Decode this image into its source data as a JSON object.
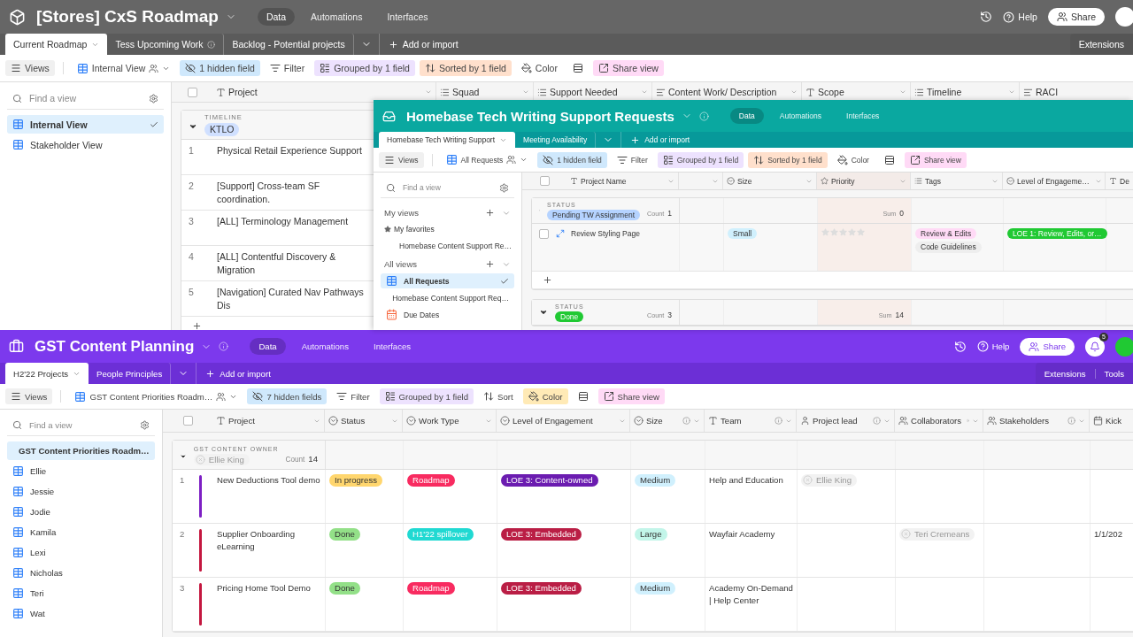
{
  "windows": [
    {
      "title": "[Stores] CxS Roadmap",
      "info": false,
      "all_selected": false,
      "nav": [
        {
          "label": "Data",
          "selected": true
        },
        {
          "label": "Automations",
          "selected": false
        },
        {
          "label": "Interfaces",
          "selected": false
        }
      ],
      "header_right": {
        "help": "Help",
        "share": "Share"
      },
      "tabs": [
        {
          "label": "Current Roadmap",
          "selected": true,
          "info": false
        },
        {
          "label": "Tess Upcoming Work",
          "selected": false,
          "info": true
        },
        {
          "label": "Backlog - Potential projects",
          "selected": false,
          "info": false
        }
      ],
      "add_label": "Add or import",
      "side_tabs": [
        "Extensions"
      ],
      "toolbar": [
        {
          "kind": "views",
          "label": "Views"
        },
        {
          "kind": "view",
          "label": "Internal View"
        },
        {
          "kind": "hidden",
          "label": "1 hidden field",
          "active": true
        },
        {
          "kind": "filter",
          "label": "Filter",
          "active": false
        },
        {
          "kind": "group",
          "label": "Grouped by 1 field",
          "active": true
        },
        {
          "kind": "sort",
          "label": "Sorted by 1 field",
          "active": true
        },
        {
          "kind": "color",
          "label": "Color",
          "active": false
        },
        {
          "kind": "row_height"
        },
        {
          "kind": "share",
          "label": "Share view"
        }
      ],
      "sidebar": {
        "placeholder": "Find a view",
        "items": [
          {
            "kind": "grid",
            "label": "Internal View",
            "selected": true
          },
          {
            "kind": "grid",
            "label": "Stakeholder View",
            "selected": false
          }
        ]
      },
      "columns": [
        {
          "kind": "text",
          "label": "Project",
          "info": false,
          "sorted": false
        },
        {
          "kind": "multi",
          "label": "Squad",
          "info": false,
          "sorted": false
        },
        {
          "kind": "multi",
          "label": "Support Needed",
          "info": false,
          "sorted": false
        },
        {
          "kind": "longtext",
          "label": "Content Work/ Description",
          "info": false,
          "sorted": false
        },
        {
          "kind": "text",
          "label": "Scope",
          "info": false,
          "sorted": false
        },
        {
          "kind": "multi",
          "label": "Timeline",
          "info": false,
          "sorted": false
        },
        {
          "kind": "longtext",
          "label": "RACI",
          "info": false,
          "sorted": false
        }
      ],
      "groups": [
        {
          "field": "TIMELINE",
          "value": {
            "kind": "tag",
            "label": "KTLO",
            "color": "#d0e0ff"
          },
          "add_row": true,
          "rows": [
            {
              "number": "1",
              "hovered": false,
              "cells": [
                {
                  "kind": "text",
                  "text": "Physical Retail Experience Support"
                }
              ]
            },
            {
              "number": "2",
              "hovered": false,
              "cells": [
                {
                  "kind": "text",
                  "text": "[Support] Cross-team SF coordination."
                }
              ]
            },
            {
              "number": "3",
              "hovered": false,
              "cells": [
                {
                  "kind": "text",
                  "text": "[ALL] Terminology Management"
                }
              ]
            },
            {
              "number": "4",
              "hovered": false,
              "cells": [
                {
                  "kind": "text",
                  "text": "[ALL] Contentful Discovery & Migration"
                }
              ]
            },
            {
              "number": "5",
              "hovered": false,
              "cells": [
                {
                  "kind": "text",
                  "text": "[Navigation] Curated Nav Pathways Dis"
                }
              ]
            }
          ]
        }
      ]
    },
    {
      "title": "Homebase Tech Writing Support Requests",
      "info": true,
      "all_selected": false,
      "nav": [
        {
          "label": "Data",
          "selected": true
        },
        {
          "label": "Automations",
          "selected": false
        },
        {
          "label": "Interfaces",
          "selected": false
        }
      ],
      "tabs": [
        {
          "label": "Homebase Tech Writing Support",
          "selected": true,
          "info": false
        },
        {
          "label": "Meeting Availability",
          "selected": false,
          "info": false
        }
      ],
      "add_label": "Add or import",
      "toolbar": [
        {
          "kind": "views",
          "label": "Views"
        },
        {
          "kind": "view",
          "label": "All Requests"
        },
        {
          "kind": "hidden",
          "label": "1 hidden field",
          "active": true
        },
        {
          "kind": "filter",
          "label": "Filter",
          "active": false
        },
        {
          "kind": "group",
          "label": "Grouped by 1 field",
          "active": true
        },
        {
          "kind": "sort",
          "label": "Sorted by 1 field",
          "active": true
        },
        {
          "kind": "color",
          "label": "Color",
          "active": false
        },
        {
          "kind": "row_height"
        },
        {
          "kind": "share",
          "label": "Share view"
        }
      ],
      "sidebar": {
        "placeholder": "Find a view",
        "items": [
          {
            "kind": "section",
            "label": "My views"
          },
          {
            "kind": "favorites",
            "label": "My favorites"
          },
          {
            "kind": "form",
            "label": "Homebase Content Support Re…",
            "selected": false
          },
          {
            "kind": "section",
            "label": "All views"
          },
          {
            "kind": "grid",
            "label": "All Requests",
            "selected": true
          },
          {
            "kind": "form",
            "label": "Homebase Content Support Req…",
            "selected": false
          },
          {
            "kind": "calendar",
            "label": "Due Dates",
            "selected": false
          }
        ]
      },
      "columns": [
        {
          "kind": "text",
          "label": "Project Name",
          "info": false,
          "sorted": false
        },
        {
          "kind": "blank",
          "info": false,
          "sorted": false
        },
        {
          "kind": "select",
          "label": "Size",
          "info": false,
          "sorted": false
        },
        {
          "kind": "rating",
          "label": "Priority",
          "info": false,
          "sorted": true
        },
        {
          "kind": "multi",
          "label": "Tags",
          "info": false,
          "sorted": false
        },
        {
          "kind": "select",
          "label": "Level of Engageme…",
          "info": false,
          "sorted": false
        },
        {
          "kind": "text",
          "label": "De",
          "sorted": false
        }
      ],
      "groups": [
        {
          "field": "STATUS",
          "value": {
            "kind": "tag",
            "label": "Pending TW Assignment",
            "color": "#b5d3ff"
          },
          "count_label": "Count",
          "count": "1",
          "sum_label": "Sum",
          "sum": "0",
          "add_row": true,
          "rows": [
            {
              "hovered": true,
              "cells": [
                {
                  "kind": "text",
                  "text": "Review Styling Page"
                },
                {
                  "kind": "blank"
                },
                {
                  "kind": "tags",
                  "tags": [
                    {
                      "label": "Small",
                      "color": "#d0f0fd"
                    }
                  ]
                },
                {
                  "kind": "stars",
                  "stars": 0
                },
                {
                  "kind": "tags",
                  "tags": [
                    {
                      "label": "Review & Edits",
                      "color": "#ffdaf6"
                    },
                    {
                      "label": "Code Guidelines",
                      "color": "#eeeeee"
                    }
                  ]
                },
                {
                  "kind": "tags",
                  "tags": [
                    {
                      "label": "LOE 1: Review, Edits, or…",
                      "color": "#20c933"
                    }
                  ]
                },
                {
                  "kind": "blank"
                }
              ]
            }
          ]
        },
        {
          "field": "STATUS",
          "value": {
            "kind": "tag",
            "label": "Done",
            "color": "#20c933"
          },
          "count_label": "Count",
          "count": "3",
          "sum_label": "Sum",
          "sum": "14",
          "add_row": false
        }
      ]
    },
    {
      "title": "GST Content Planning",
      "info": true,
      "all_selected": false,
      "nav": [
        {
          "label": "Data",
          "selected": true
        },
        {
          "label": "Automations",
          "selected": false
        },
        {
          "label": "Interfaces",
          "selected": false
        }
      ],
      "header_right": {
        "help": "Help",
        "share": "Share",
        "notifications": "5"
      },
      "tabs": [
        {
          "label": "H2'22 Projects",
          "selected": true,
          "info": false
        },
        {
          "label": "People Principles",
          "selected": false,
          "info": false
        }
      ],
      "add_label": "Add or import",
      "side_tabs": [
        "Extensions",
        "Tools"
      ],
      "toolbar": [
        {
          "kind": "views",
          "label": "Views"
        },
        {
          "kind": "view",
          "label": "GST Content Priorities Roadm…"
        },
        {
          "kind": "hidden",
          "label": "7 hidden fields",
          "active": true
        },
        {
          "kind": "filter",
          "label": "Filter",
          "active": false
        },
        {
          "kind": "group",
          "label": "Grouped by 1 field",
          "active": true
        },
        {
          "kind": "sort",
          "label": "Sort",
          "active": false
        },
        {
          "kind": "color",
          "label": "Color",
          "active": true
        },
        {
          "kind": "row_height"
        },
        {
          "kind": "share",
          "label": "Share view"
        }
      ],
      "sidebar": {
        "placeholder": "Find a view",
        "items": [
          {
            "kind": "grid",
            "label": "GST Content Priorities Roadm…",
            "selected": true
          },
          {
            "kind": "grid",
            "label": "Ellie",
            "selected": false
          },
          {
            "kind": "grid",
            "label": "Jessie",
            "selected": false
          },
          {
            "kind": "grid",
            "label": "Jodie",
            "selected": false
          },
          {
            "kind": "grid",
            "label": "Kamila",
            "selected": false
          },
          {
            "kind": "grid",
            "label": "Lexi",
            "selected": false
          },
          {
            "kind": "grid",
            "label": "Nicholas",
            "selected": false
          },
          {
            "kind": "grid",
            "label": "Teri",
            "selected": false
          },
          {
            "kind": "grid",
            "label": "Wat",
            "selected": false
          }
        ]
      },
      "columns": [
        {
          "kind": "text",
          "label": "Project",
          "info": false,
          "sorted": false
        },
        {
          "kind": "select",
          "label": "Status",
          "info": false,
          "sorted": false
        },
        {
          "kind": "select",
          "label": "Work Type",
          "info": false,
          "sorted": false
        },
        {
          "kind": "select",
          "label": "Level of Engagement",
          "info": false,
          "sorted": false
        },
        {
          "kind": "select",
          "label": "Size",
          "info": true,
          "sorted": false
        },
        {
          "kind": "text",
          "label": "Team",
          "info": true,
          "sorted": false
        },
        {
          "kind": "user",
          "label": "Project lead",
          "info": true,
          "sorted": false
        },
        {
          "kind": "users",
          "label": "Collaborators",
          "info": true,
          "sorted": false
        },
        {
          "kind": "users",
          "label": "Stakeholders",
          "info": true,
          "sorted": false
        },
        {
          "kind": "date",
          "label": "Kick",
          "sorted": false
        }
      ],
      "groups": [
        {
          "field": "GST CONTENT OWNER",
          "value": {
            "kind": "person",
            "label": "Ellie King"
          },
          "count_label": "Count",
          "count": "14",
          "add_row": false,
          "rows": [
            {
              "number": "1",
              "hovered": false,
              "color": "#7d1fc4",
              "cells": [
                {
                  "kind": "text",
                  "text": "New Deductions Tool demo"
                },
                {
                  "kind": "tags",
                  "tags": [
                    {
                      "label": "In progress",
                      "color": "#ffd66e"
                    }
                  ]
                },
                {
                  "kind": "tags",
                  "tags": [
                    {
                      "label": "Roadmap",
                      "color": "#f82b60"
                    }
                  ]
                },
                {
                  "kind": "tags",
                  "tags": [
                    {
                      "label": "LOE 3: Content-owned",
                      "color": "#6b1cb0"
                    }
                  ]
                },
                {
                  "kind": "tags",
                  "tags": [
                    {
                      "label": "Medium",
                      "color": "#d0f0fd"
                    }
                  ]
                },
                {
                  "kind": "text",
                  "text": "Help and Education"
                },
                {
                  "kind": "person",
                  "name": "Ellie King"
                },
                {
                  "kind": "blank"
                },
                {
                  "kind": "blank"
                },
                {
                  "kind": "blank"
                }
              ]
            },
            {
              "number": "2",
              "hovered": false,
              "color": "#c4173f",
              "cells": [
                {
                  "kind": "text",
                  "text": "Supplier Onboarding eLearning"
                },
                {
                  "kind": "tags",
                  "tags": [
                    {
                      "label": "Done",
                      "color": "#93e088"
                    }
                  ]
                },
                {
                  "kind": "tags",
                  "tags": [
                    {
                      "label": "H1'22 spillover",
                      "color": "#20d9d2"
                    }
                  ]
                },
                {
                  "kind": "tags",
                  "tags": [
                    {
                      "label": "LOE 3: Embedded",
                      "color": "#ba1e45"
                    }
                  ]
                },
                {
                  "kind": "tags",
                  "tags": [
                    {
                      "label": "Large",
                      "color": "#c2f5e9"
                    }
                  ]
                },
                {
                  "kind": "text",
                  "text": "Wayfair Academy"
                },
                {
                  "kind": "blank"
                },
                {
                  "kind": "person",
                  "name": "Teri Cremeans"
                },
                {
                  "kind": "blank"
                },
                {
                  "kind": "text",
                  "text": "1/1/202"
                }
              ]
            },
            {
              "number": "3",
              "hovered": false,
              "color": "#c4173f",
              "cells": [
                {
                  "kind": "text",
                  "text": "Pricing Home Tool Demo"
                },
                {
                  "kind": "tags",
                  "tags": [
                    {
                      "label": "Done",
                      "color": "#93e088"
                    }
                  ]
                },
                {
                  "kind": "tags",
                  "tags": [
                    {
                      "label": "Roadmap",
                      "color": "#f82b60"
                    }
                  ]
                },
                {
                  "kind": "tags",
                  "tags": [
                    {
                      "label": "LOE 3: Embedded",
                      "color": "#ba1e45"
                    }
                  ]
                },
                {
                  "kind": "tags",
                  "tags": [
                    {
                      "label": "Medium",
                      "color": "#d0f0fd"
                    }
                  ]
                },
                {
                  "kind": "text",
                  "text": "Academy On-Demand | Help Center"
                },
                {
                  "kind": "blank"
                },
                {
                  "kind": "blank"
                },
                {
                  "kind": "blank"
                },
                {
                  "kind": "blank"
                }
              ]
            }
          ]
        }
      ]
    }
  ]
}
